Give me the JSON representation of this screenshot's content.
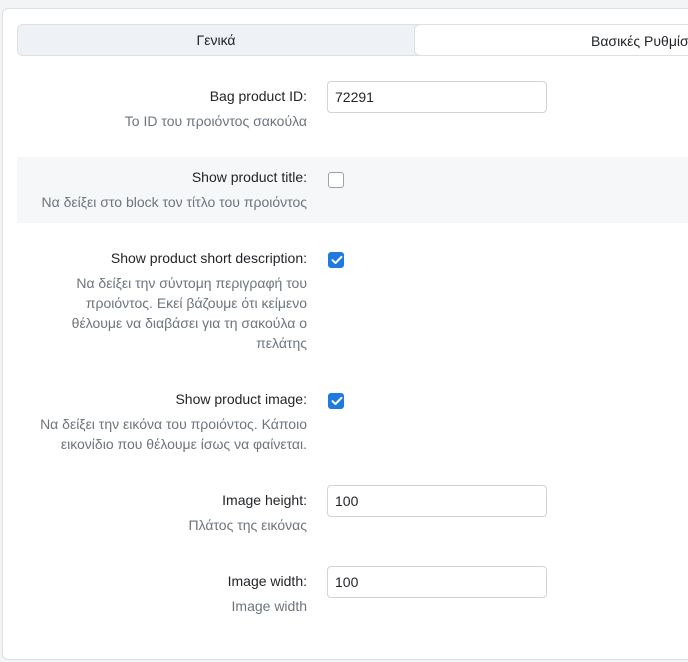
{
  "tabs": [
    {
      "label": "Γενικά"
    },
    {
      "label": "Βασικές Ρυθμίσ"
    }
  ],
  "fields": {
    "bag_product_id": {
      "label": "Bag product ID:",
      "help": "Το ID του προιόντος σακούλα",
      "value": "72291"
    },
    "show_title": {
      "label": "Show product title:",
      "help": "Να δείξει στο block τον τίτλο του προιόντος",
      "checked": false
    },
    "show_short_desc": {
      "label": "Show product short description:",
      "help_lines": [
        "Να δείξει την σύντομη περιγραφή του",
        "προιόντος. Εκεί βάζουμε ότι κείμενο",
        "θέλουμε να διαβάσει για τη σακούλα ο",
        "πελάτης"
      ],
      "checked": true
    },
    "show_image": {
      "label": "Show product image:",
      "help_lines": [
        "Να δείξει την εικόνα του προιόντος. Κάποιο",
        "εικονίδιο που θέλουμε ίσως να φαίνεται."
      ],
      "checked": true
    },
    "image_height": {
      "label": "Image height:",
      "help": "Πλάτος της εικόνας",
      "value": "100"
    },
    "image_width": {
      "label": "Image width:",
      "help": "Image width",
      "value": "100"
    }
  },
  "colors": {
    "accent": "#1f7ae0",
    "shaded_row": "#f6f7f9",
    "help_text": "#6c757d"
  }
}
